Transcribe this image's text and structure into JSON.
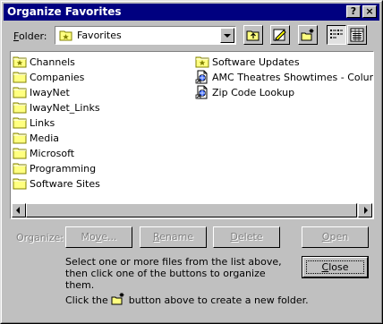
{
  "window": {
    "title": "Organize Favorites",
    "help_glyph": "?",
    "close_glyph": "×"
  },
  "folder": {
    "label_access": "F",
    "label_rest": "older:",
    "value": "Favorites"
  },
  "toolbar": {
    "icons": [
      "up-one-level-icon",
      "favorites-update-icon",
      "new-folder-icon",
      "list-view-icon",
      "details-view-icon"
    ]
  },
  "list": {
    "left_column": [
      {
        "name": "Channels",
        "icon": "channels-folder-icon"
      },
      {
        "name": "Companies",
        "icon": "folder-icon"
      },
      {
        "name": "IwayNet",
        "icon": "folder-icon"
      },
      {
        "name": "IwayNet_Links",
        "icon": "folder-icon"
      },
      {
        "name": "Links",
        "icon": "folder-icon"
      },
      {
        "name": "Media",
        "icon": "folder-icon"
      },
      {
        "name": "Microsoft",
        "icon": "folder-icon"
      },
      {
        "name": "Programming",
        "icon": "folder-icon"
      },
      {
        "name": "Software Sites",
        "icon": "folder-icon"
      }
    ],
    "right_column": [
      {
        "name": "Software Updates",
        "icon": "channels-folder-icon"
      },
      {
        "name": "AMC Theatres Showtimes - Columbus",
        "icon": "internet-shortcut-icon"
      },
      {
        "name": "Zip Code Lookup",
        "icon": "internet-shortcut-icon"
      }
    ]
  },
  "organize": {
    "label": "Organize:",
    "move": {
      "access": "v",
      "before": "Mo",
      "after": "e..."
    },
    "rename": {
      "access": "R",
      "before": "",
      "after": "ename"
    },
    "delete": {
      "access": "D",
      "before": "",
      "after": "elete"
    },
    "open": {
      "access": "O",
      "before": "",
      "after": "pen"
    }
  },
  "description": "Select one or more files from the list above, then click one of the buttons to organize them.",
  "close_button": {
    "access": "C",
    "after": "lose"
  },
  "hint": {
    "before": "Click the",
    "after": "button above to create a new folder."
  },
  "colors": {
    "titlebar": "#000080",
    "face": "#c0c0c0",
    "folder": "#ffff80"
  }
}
